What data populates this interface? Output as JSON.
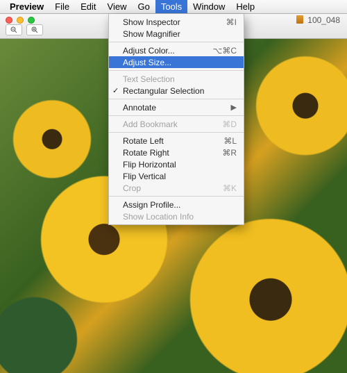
{
  "menubar": {
    "app": "Preview",
    "items": [
      "File",
      "Edit",
      "View",
      "Go",
      "Tools",
      "Window",
      "Help"
    ],
    "active_index": 4
  },
  "window": {
    "title_prefix": "100_048"
  },
  "dropdown": {
    "groups": [
      [
        {
          "label": "Show Inspector",
          "shortcut": "⌘I",
          "enabled": true
        },
        {
          "label": "Show Magnifier",
          "shortcut": "",
          "enabled": true
        }
      ],
      [
        {
          "label": "Adjust Color...",
          "shortcut": "⌥⌘C",
          "enabled": true
        },
        {
          "label": "Adjust Size...",
          "shortcut": "",
          "enabled": true,
          "highlight": true
        }
      ],
      [
        {
          "label": "Text Selection",
          "shortcut": "",
          "enabled": false
        },
        {
          "label": "Rectangular Selection",
          "shortcut": "",
          "enabled": true,
          "checked": true
        }
      ],
      [
        {
          "label": "Annotate",
          "shortcut": "",
          "enabled": true,
          "submenu": true
        }
      ],
      [
        {
          "label": "Add Bookmark",
          "shortcut": "⌘D",
          "enabled": false
        }
      ],
      [
        {
          "label": "Rotate Left",
          "shortcut": "⌘L",
          "enabled": true
        },
        {
          "label": "Rotate Right",
          "shortcut": "⌘R",
          "enabled": true
        },
        {
          "label": "Flip Horizontal",
          "shortcut": "",
          "enabled": true
        },
        {
          "label": "Flip Vertical",
          "shortcut": "",
          "enabled": true
        },
        {
          "label": "Crop",
          "shortcut": "⌘K",
          "enabled": false
        }
      ],
      [
        {
          "label": "Assign Profile...",
          "shortcut": "",
          "enabled": true
        },
        {
          "label": "Show Location Info",
          "shortcut": "",
          "enabled": false
        }
      ]
    ]
  }
}
